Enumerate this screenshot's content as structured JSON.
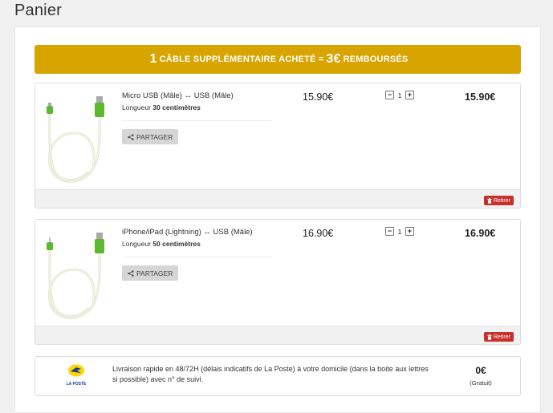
{
  "page": {
    "title": "Panier"
  },
  "promo": {
    "num": "1",
    "text": "CÂBLE SUPPLÉMENTAIRE ACHETÉ =",
    "amount": "3€",
    "suffix": "REMBOURSÉS"
  },
  "items": [
    {
      "name": "Micro USB (Mâle) ↔ USB (Mâle)",
      "length_prefix": "Longueur",
      "length_value": "30 centimètres",
      "share_label": "PARTAGER",
      "price": "15.90€",
      "quantity": "1",
      "total": "15.90€",
      "remove_label": "Retirer",
      "image_icon": "usb-cable-icon"
    },
    {
      "name": "iPhone/iPad (Lightning) ↔ USB (Mâle)",
      "length_prefix": "Longueur",
      "length_value": "50 centimètres",
      "share_label": "PARTAGER",
      "price": "16.90€",
      "quantity": "1",
      "total": "16.90€",
      "remove_label": "Retirer",
      "image_icon": "usb-cable-icon"
    }
  ],
  "delivery": {
    "logo_text": "LA POSTE",
    "description": "Livraison rapide en 48/72H (délais indicatifs de La Poste) à votre domicile (dans la boite aux lettres si possible) avec n° de suivi.",
    "price": "0€",
    "note": "(Gratuit)"
  },
  "colors": {
    "banner": "#d8a400",
    "remove": "#c9302c",
    "cable_green": "#5cb82e"
  }
}
